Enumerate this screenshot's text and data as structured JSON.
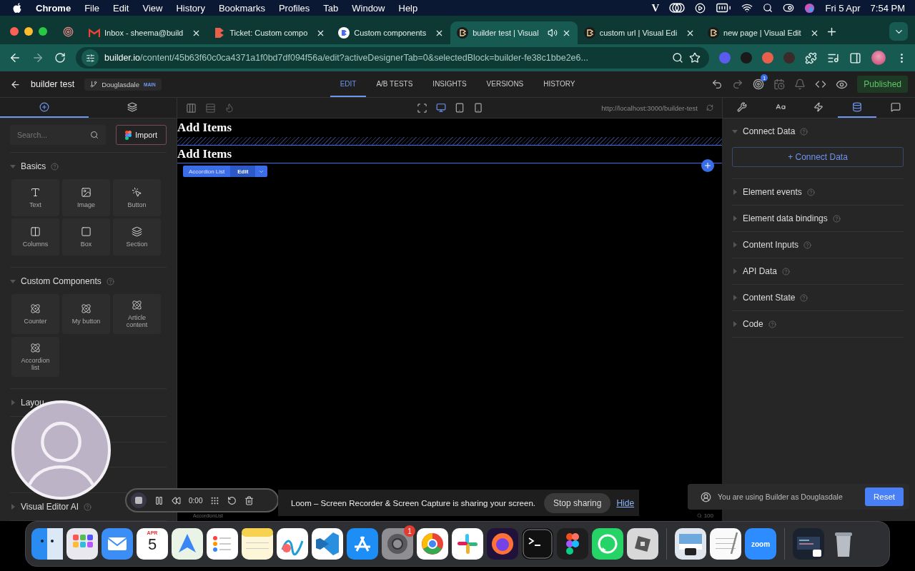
{
  "menu_bar": {
    "app": "Chrome",
    "items": [
      "File",
      "Edit",
      "View",
      "History",
      "Bookmarks",
      "Profiles",
      "Tab",
      "Window",
      "Help"
    ],
    "status_letter": "V",
    "date": "Fri 5 Apr",
    "time": "7:54 PM"
  },
  "browser": {
    "tabs": [
      {
        "title": "Inbox - sheema@build",
        "selected": false,
        "audio": false
      },
      {
        "title": "Ticket: Custom compo",
        "selected": false,
        "audio": false
      },
      {
        "title": "Custom components",
        "selected": false,
        "audio": false
      },
      {
        "title": "builder test | Visual",
        "selected": true,
        "audio": true
      },
      {
        "title": "custom url | Visual Edi",
        "selected": false,
        "audio": false
      },
      {
        "title": "new page | Visual Edit",
        "selected": false,
        "audio": false
      }
    ],
    "address": {
      "host": "builder.io",
      "path": "/content/45b63f60c0ca4371a1f0bd7df094f56a/edit?activeDesignerTab=0&selectedBlock=builder-fe38c1bbe2e6..."
    }
  },
  "header": {
    "title": "builder test",
    "branch": "Douglasdale",
    "branch_badge": "MAIN",
    "tabs": [
      {
        "label": "EDIT",
        "selected": true
      },
      {
        "label": "A/B TESTS",
        "selected": false
      },
      {
        "label": "INSIGHTS",
        "selected": false
      },
      {
        "label": "VERSIONS",
        "selected": false
      },
      {
        "label": "HISTORY",
        "selected": false
      }
    ],
    "notification_count": "1",
    "publish": "Published"
  },
  "toolbar": {
    "left_tabs": [
      {
        "selected": true
      },
      {
        "selected": false
      }
    ],
    "devices": [
      {
        "selected": true
      },
      {
        "selected": false
      },
      {
        "selected": false
      }
    ],
    "preview_url": "http://localhost:3000/builder-test",
    "right_tabs": [
      {
        "selected": false
      },
      {
        "selected": false
      },
      {
        "selected": false
      },
      {
        "selected": true
      },
      {
        "selected": false
      }
    ]
  },
  "left_panel": {
    "search_placeholder": "Search...",
    "import": "Import",
    "sections": [
      {
        "title": "Basics",
        "expanded": true,
        "help": true,
        "kind": "basic",
        "blocks": [
          "Text",
          "Image",
          "Button",
          "Columns",
          "Box",
          "Section"
        ]
      },
      {
        "title": "Custom Components",
        "expanded": true,
        "help": true,
        "kind": "custom",
        "blocks": [
          "Counter",
          "My button",
          "Article content",
          "Accordion list"
        ]
      },
      {
        "title": "Layou",
        "expanded": false,
        "help": false
      },
      {
        "title": "Visual Editor AI",
        "expanded": false,
        "help": true
      }
    ]
  },
  "canvas": {
    "blocks": [
      {
        "text": "Add Items",
        "selected": false
      },
      {
        "text": "Add Items",
        "selected": true
      }
    ],
    "selection_label": "Accordion List",
    "edit": "Edit",
    "footer_label": "AccordionList",
    "zoom": "100"
  },
  "right_panel": {
    "sections": [
      {
        "title": "Connect Data",
        "expanded": true,
        "action": "+ Connect Data"
      },
      {
        "title": "Element events",
        "expanded": false
      },
      {
        "title": "Element data bindings",
        "expanded": false
      },
      {
        "title": "Content Inputs",
        "expanded": false
      },
      {
        "title": "API Data",
        "expanded": false
      },
      {
        "title": "Content State",
        "expanded": false
      },
      {
        "title": "Code",
        "expanded": false
      }
    ]
  },
  "recorder": {
    "time": "0:00"
  },
  "loom": {
    "message": "Loom – Screen Recorder & Screen Capture is sharing your screen.",
    "stop": "Stop sharing",
    "hide": "Hide"
  },
  "toast": {
    "message": "You are using Builder as Douglasdale",
    "action": "Reset"
  },
  "dock": {
    "calendar_month": "APR",
    "calendar_day": "5",
    "badge": "1",
    "zoom_label": "zoom"
  }
}
